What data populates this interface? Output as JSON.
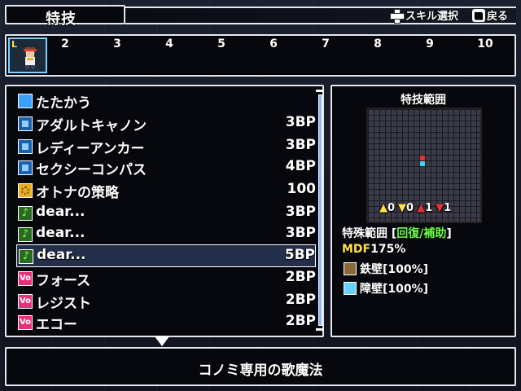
{
  "header": {
    "title": "特技",
    "hint_skill_label": "スキル選択",
    "hint_back_label": "戻る",
    "hint_back_glyph": "⊠"
  },
  "party": {
    "selected_badge": "L",
    "slots": [
      "2",
      "3",
      "4",
      "5",
      "6",
      "7",
      "8",
      "9",
      "10"
    ]
  },
  "skills": [
    {
      "name": "たたかう",
      "cost": "",
      "icon": "sword-icon",
      "color": "#3aa0ff"
    },
    {
      "name": "アダルトキャノン",
      "cost": "3BP",
      "icon": "skill-blue-icon",
      "color": "#3aa0ff"
    },
    {
      "name": "レディーアンカー",
      "cost": "3BP",
      "icon": "skill-blue-icon",
      "color": "#3aa0ff"
    },
    {
      "name": "セクシーコンパス",
      "cost": "4BP",
      "icon": "skill-blue-icon",
      "color": "#3aa0ff"
    },
    {
      "name": "オトナの策略",
      "cost": "100",
      "icon": "strategy-icon",
      "color": "#e8b020"
    },
    {
      "name": "dear...",
      "cost": "3BP",
      "icon": "music-green-icon",
      "color": "#58c040"
    },
    {
      "name": "dear...",
      "cost": "3BP",
      "icon": "music-green-icon",
      "color": "#58c040"
    },
    {
      "name": "dear...",
      "cost": "5BP",
      "icon": "music-green-icon",
      "color": "#58c040"
    },
    {
      "name": "フォース",
      "cost": "2BP",
      "icon": "vo-icon",
      "color": "#e8307a"
    },
    {
      "name": "レジスト",
      "cost": "2BP",
      "icon": "vo-icon",
      "color": "#e8307a"
    },
    {
      "name": "エコー",
      "cost": "2BP",
      "icon": "vo-icon",
      "color": "#e8307a"
    }
  ],
  "selected_skill_index": 7,
  "range_panel": {
    "title": "特技範囲",
    "stats": [
      {
        "icon": "stat-yellow-icon",
        "value": "0"
      },
      {
        "icon": "stat-yellow-icon",
        "value": "0"
      },
      {
        "icon": "stat-red-up-icon",
        "value": "1"
      },
      {
        "icon": "stat-red-down-icon",
        "value": "1"
      }
    ],
    "special_label": "特殊範囲 [",
    "special_type": "回復/補助",
    "special_close": "]",
    "mdf_label": "MDF",
    "mdf_value": "175%",
    "buffs": [
      {
        "icon": "iron-wall-icon",
        "label": "鉄壁[100%]"
      },
      {
        "icon": "barrier-icon",
        "label": "障壁[100%]"
      }
    ]
  },
  "description": "コノミ専用の歌魔法",
  "colors": {
    "panel_border": "#e8e8f0",
    "highlight_green": "#6cff4a",
    "highlight_yellow": "#ffe14a",
    "grid_red": "#e8303a",
    "grid_cyan": "#40d8e8"
  }
}
